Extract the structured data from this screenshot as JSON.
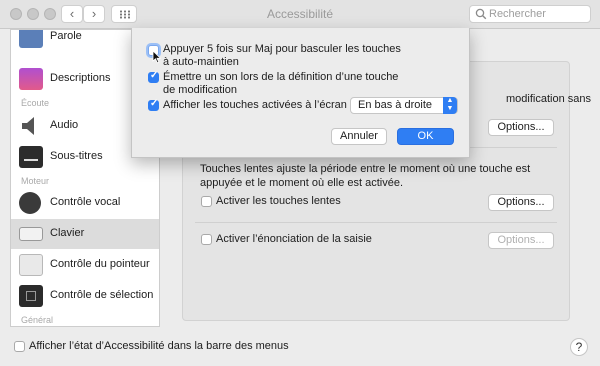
{
  "window": {
    "title": "Accessibilité"
  },
  "toolbar": {
    "back_icon": "chevron-left-icon",
    "forward_icon": "chevron-right-icon",
    "grid_icon": "grid-icon"
  },
  "search": {
    "placeholder": "Rechercher",
    "value": ""
  },
  "sidebar": {
    "items": [
      {
        "label": "Parole",
        "icon": "speech-icon"
      },
      {
        "label": "Descriptions",
        "icon": "descriptions-icon"
      },
      {
        "label": "Audio",
        "icon": "speaker-icon"
      },
      {
        "label": "Sous-titres",
        "icon": "subtitles-icon"
      },
      {
        "label": "Contrôle vocal",
        "icon": "voice-control-icon"
      },
      {
        "label": "Clavier",
        "icon": "keyboard-icon",
        "selected": true
      },
      {
        "label": "Contrôle du pointeur",
        "icon": "pointer-icon"
      },
      {
        "label": "Contrôle de sélection",
        "icon": "switch-control-icon"
      }
    ],
    "sections": {
      "ecoute": "Écoute",
      "moteur": "Moteur",
      "general": "Général"
    }
  },
  "main": {
    "partial_text": "modification sans",
    "options_label": "Options...",
    "slow_keys_desc_line1": "Touches lentes ajuste la période entre le moment où une touche est",
    "slow_keys_desc_line2": "appuyée et le moment où elle est activée.",
    "slow_keys_label": "Activer les touches lentes",
    "typing_feedback_label": "Activer l’énonciation de la saisie"
  },
  "dialog": {
    "opt1_line1": "Appuyer 5 fois sur Maj pour basculer les touches",
    "opt1_line2": "à auto-maintien",
    "opt1_checked": false,
    "opt2_line1": "Émettre un son lors de la définition d’une touche",
    "opt2_line2": "de modification",
    "opt2_checked": true,
    "opt3_label": "Afficher les touches activées à l’écran :",
    "opt3_checked": true,
    "position_value": "En bas à droite",
    "cancel_label": "Annuler",
    "ok_label": "OK"
  },
  "footer": {
    "menu_status_label": "Afficher l’état d’Accessibilité dans la barre des menus",
    "help_label": "?"
  },
  "colors": {
    "accent": "#2f7ef3",
    "window_bg": "#ececec"
  }
}
